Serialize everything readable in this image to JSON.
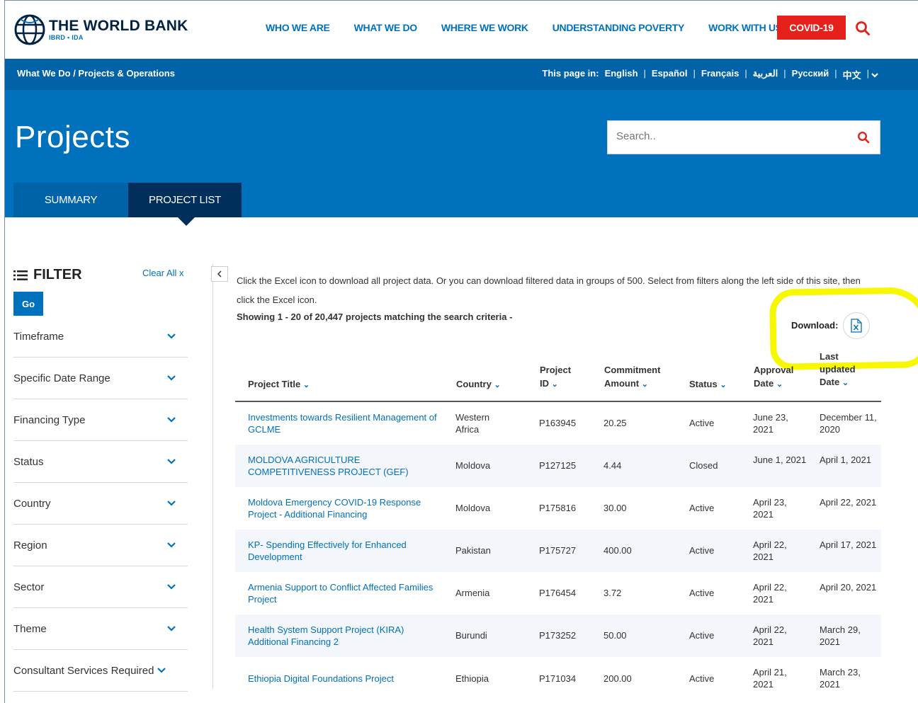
{
  "header": {
    "logo_title": "THE WORLD BANK",
    "logo_sub": "IBRD • IDA",
    "nav": [
      "WHO WE ARE",
      "WHAT WE DO",
      "WHERE WE WORK",
      "UNDERSTANDING POVERTY",
      "WORK WITH US"
    ],
    "covid_label": "COVID-19"
  },
  "breadcrumb": "What We Do / Projects & Operations",
  "languages": {
    "prefix": "This page in:",
    "items": [
      "English",
      "Español",
      "Français",
      "العربية",
      "Русский",
      "中文"
    ]
  },
  "page": {
    "title": "Projects",
    "search_placeholder": "Search.."
  },
  "tabs": [
    {
      "label": "SUMMARY"
    },
    {
      "label": "PROJECT LIST"
    }
  ],
  "filter": {
    "title": "FILTER",
    "clear_all": "Clear All x",
    "go_label": "Go",
    "items": [
      "Timeframe",
      "Specific Date Range",
      "Financing Type",
      "Status",
      "Country",
      "Region",
      "Sector",
      "Theme",
      "Consultant Services Required"
    ]
  },
  "content": {
    "info": "Click the Excel icon to download all project data. Or you can download filtered data in groups of 500. Select from filters along the left side of this site, then click the Excel icon.",
    "showing": "Showing 1 - 20 of 20,447 projects matching the search criteria -",
    "download_label": "Download:"
  },
  "table": {
    "headers": {
      "title": "Project Title",
      "country": "Country",
      "pid_1": "Project",
      "pid_2": "ID",
      "amt_1": "Commitment",
      "amt_2": "Amount",
      "status": "Status",
      "appr_1": "Approval",
      "appr_2": "Date",
      "upd_1": "Last",
      "upd_2": "updated",
      "upd_3": "Date"
    },
    "rows": [
      {
        "title": "Investments towards Resilient Management of GCLME",
        "country": "Western Africa",
        "pid": "P163945",
        "amount": "20.25",
        "status": "Active",
        "approval": "June 23, 2021",
        "updated": "December 11, 2020"
      },
      {
        "title": "MOLDOVA AGRICULTURE COMPETITIVENESS PROJECT (GEF)",
        "country": "Moldova",
        "pid": "P127125",
        "amount": "4.44",
        "status": "Closed",
        "approval": "June 1, 2021",
        "updated": "April 1, 2021"
      },
      {
        "title": "Moldova Emergency COVID-19 Response Project - Additional Financing",
        "country": "Moldova",
        "pid": "P175816",
        "amount": "30.00",
        "status": "Active",
        "approval": "April 23, 2021",
        "updated": "April 22, 2021"
      },
      {
        "title": "KP- Spending Effectively for Enhanced Development",
        "country": "Pakistan",
        "pid": "P175727",
        "amount": "400.00",
        "status": "Active",
        "approval": "April 22, 2021",
        "updated": "April 17, 2021"
      },
      {
        "title": "Armenia Support to Conflict Affected Families Project",
        "country": "Armenia",
        "pid": "P176454",
        "amount": "3.72",
        "status": "Active",
        "approval": "April 22, 2021",
        "updated": "April 20, 2021"
      },
      {
        "title": "Health System Support Project (KIRA) Additional Financing 2",
        "country": "Burundi",
        "pid": "P173252",
        "amount": "50.00",
        "status": "Active",
        "approval": "April 22, 2021",
        "updated": "March 29, 2021"
      },
      {
        "title": "Ethiopia Digital Foundations Project",
        "country": "Ethiopia",
        "pid": "P171034",
        "amount": "200.00",
        "status": "Active",
        "approval": "April 21, 2021",
        "updated": "March 23, 2021"
      }
    ]
  },
  "colors": {
    "brand_blue": "#0071bc",
    "dark_navy": "#002f5c",
    "covid_red": "#e4221b",
    "highlight_yellow": "#f7f700"
  }
}
